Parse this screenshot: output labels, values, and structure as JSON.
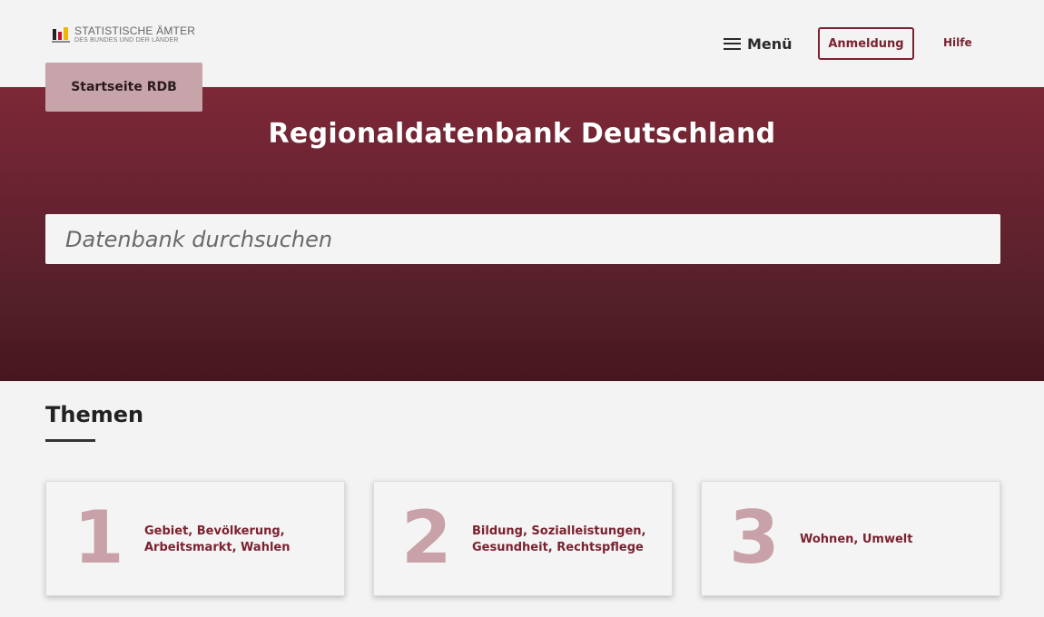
{
  "header": {
    "logo": {
      "line1": "STATISTISCHE ÄMTER",
      "line2": "DES BUNDES UND DER LÄNDER"
    },
    "menu_label": "Menü",
    "login_label": "Anmeldung",
    "help_label": "Hilfe"
  },
  "hero": {
    "home_tab": "Startseite RDB",
    "title": "Regionaldatenbank Deutschland",
    "search_placeholder": "Datenbank durchsuchen"
  },
  "themes": {
    "title": "Themen",
    "cards": [
      {
        "number": "1",
        "line1": "Gebiet, Bevölkerung,",
        "line2": "Arbeitsmarkt, Wahlen"
      },
      {
        "number": "2",
        "line1": "Bildung, Sozialleistungen,",
        "line2": "Gesundheit, Rechtspflege"
      },
      {
        "number": "3",
        "line1": "Wohnen, Umwelt",
        "line2": ""
      }
    ]
  },
  "colors": {
    "brand": "#7a2230",
    "hero_top": "#7d2837",
    "hero_bottom": "#46161f",
    "card_number": "#c8a2a8",
    "home_tab": "#c6a4a9"
  }
}
